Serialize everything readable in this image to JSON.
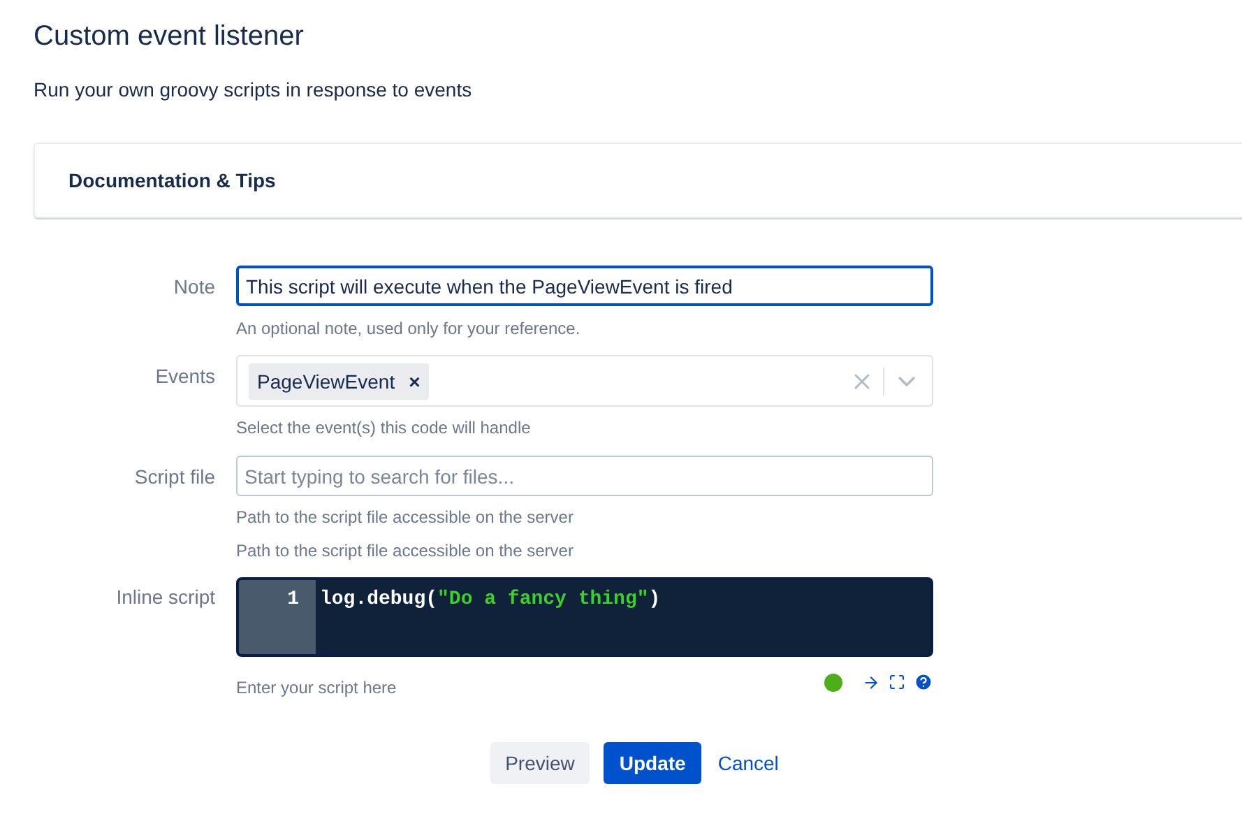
{
  "header": {
    "title": "Custom event listener",
    "subtitle": "Run your own groovy scripts in response to events"
  },
  "documentation_panel": {
    "title": "Documentation & Tips"
  },
  "form": {
    "note": {
      "label": "Note",
      "value": "This script will execute when the PageViewEvent is fired",
      "help": "An optional note, used only for your reference.",
      "focused": true
    },
    "events": {
      "label": "Events",
      "tags": [
        {
          "label": "PageViewEvent",
          "remove": "×"
        }
      ],
      "help": "Select the event(s) this code will handle"
    },
    "script_file": {
      "label": "Script file",
      "placeholder": "Start typing to search for files...",
      "help": [
        "Path to the script file accessible on the server",
        "Path to the script file accessible on the server"
      ]
    },
    "inline_script": {
      "label": "Inline script",
      "lines": [
        {
          "number": "1",
          "tokens": [
            {
              "kind": "plain",
              "text": "log.debug("
            },
            {
              "kind": "string",
              "text": "\"Do a fancy thing\""
            },
            {
              "kind": "plain",
              "text": ")"
            }
          ]
        }
      ],
      "help": "Enter your script here",
      "status": {
        "color": "#4caf1a"
      }
    }
  },
  "buttons": [
    {
      "label": "Preview",
      "kind": "secondary"
    },
    {
      "label": "Update",
      "kind": "primary"
    },
    {
      "label": "Cancel",
      "kind": "link"
    }
  ]
}
